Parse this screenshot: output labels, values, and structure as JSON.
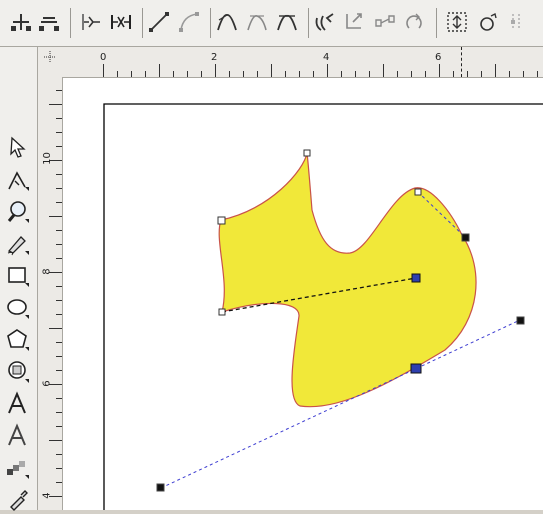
{
  "toolbar": {
    "icons": [
      "add-node-icon",
      "delete-node-icon",
      "join-nodes-icon",
      "break-curve-icon",
      "to-line-icon",
      "to-curve-icon",
      "cusp-node-icon",
      "smooth-node-icon",
      "symmetrical-node-icon",
      "reverse-direction-icon",
      "extend-curve-icon",
      "extract-subpath-icon",
      "auto-close-icon",
      "stretch-scale-icon",
      "rotate-skew-icon",
      "align-nodes-icon"
    ]
  },
  "toolbox": {
    "icons": [
      "pick-tool-icon",
      "shape-tool-icon",
      "zoom-tool-icon",
      "freehand-tool-icon",
      "rectangle-tool-icon",
      "ellipse-tool-icon",
      "polygon-tool-icon",
      "basic-shapes-tool-icon",
      "text-tool-icon",
      "text-tool-2-icon",
      "interactive-blend-icon",
      "eyedropper-tool-icon"
    ]
  },
  "hruler": {
    "labels": [
      "0",
      "2",
      "4",
      "6"
    ]
  },
  "vruler": {
    "labels": [
      "10",
      "8",
      "6",
      "4"
    ]
  },
  "colors": {
    "shape_fill": "#f1e839",
    "shape_outline": "#c9534a",
    "control_line": "#3d3dd1",
    "ui_bg": "#f0efec"
  }
}
